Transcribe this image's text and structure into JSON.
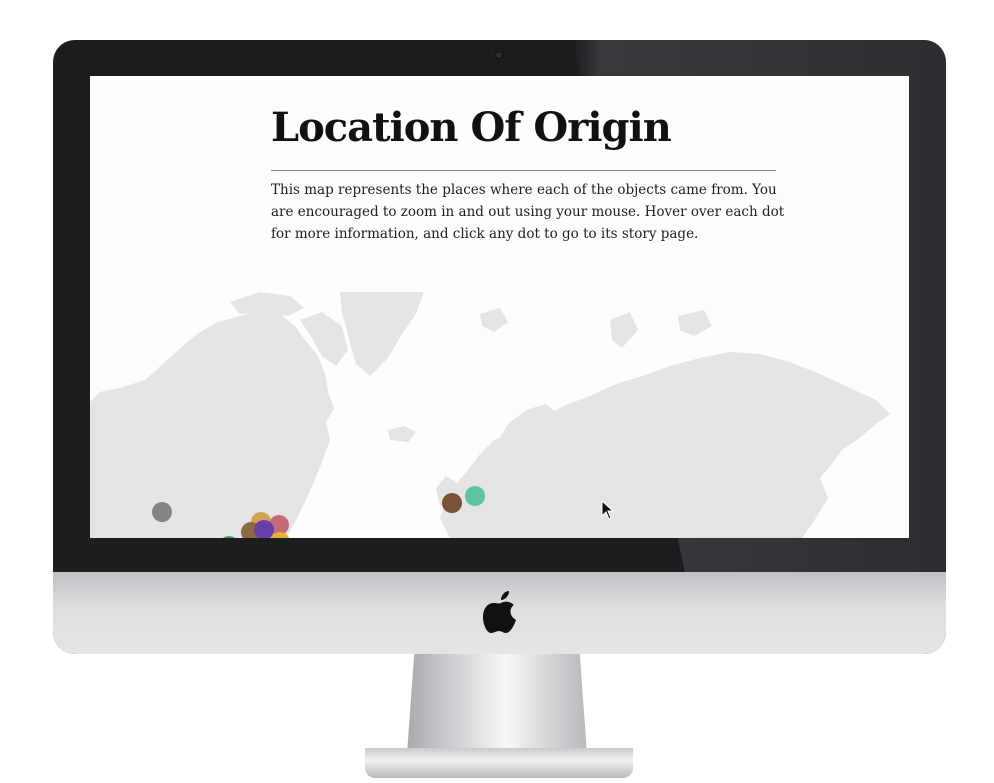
{
  "page": {
    "title": "Location Of Origin",
    "description": "This map represents the places where each of the objects came from. You are encouraged to zoom in and out using your mouse. Hover over each dot for more information, and click any dot to go to its story page."
  },
  "map": {
    "land_color": "#e4e4e4",
    "markers": [
      {
        "color": "#848484"
      },
      {
        "color": "#7a5238"
      },
      {
        "color": "#5cc3a8"
      },
      {
        "color": "#d3a24e"
      },
      {
        "color": "#c46b7a"
      },
      {
        "color": "#8e6a44"
      },
      {
        "color": "#6a3ea8"
      },
      {
        "color": "#e5b23a"
      },
      {
        "color": "#4b9a56"
      }
    ]
  },
  "icons": {
    "logo": "apple-logo-icon",
    "cursor": "mouse-pointer-icon"
  }
}
